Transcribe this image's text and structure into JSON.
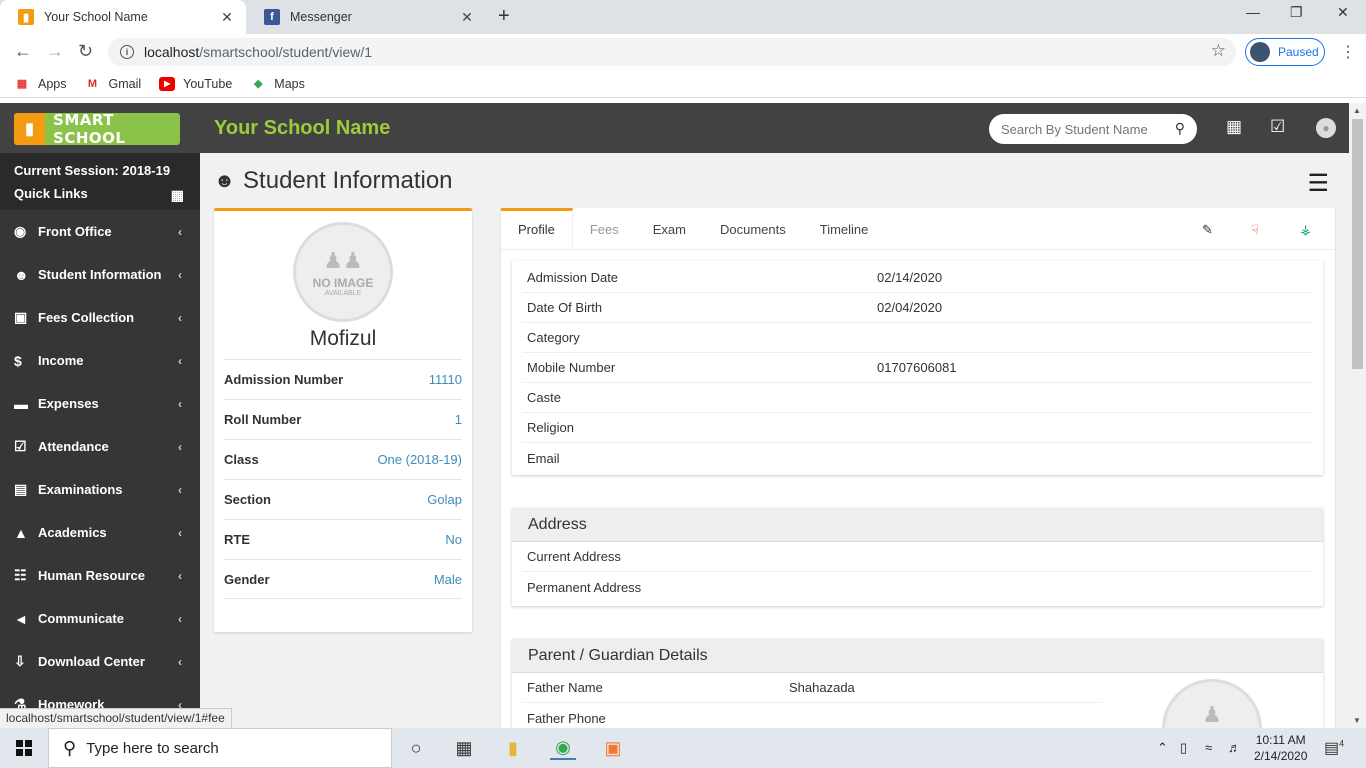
{
  "browser": {
    "tabs": [
      {
        "title": "Your School Name"
      },
      {
        "title": "Messenger"
      }
    ],
    "url_host": "localhost",
    "url_path": "/smartschool/student/view/1",
    "profile_label": "Paused",
    "bookmarks": [
      "Apps",
      "Gmail",
      "YouTube",
      "Maps"
    ]
  },
  "header": {
    "logo_text": "SMART SCHOOL",
    "school_name": "Your School Name",
    "search_placeholder": "Search By Student Name"
  },
  "sidebar": {
    "session": "Current Session: 2018-19",
    "quick_links": "Quick Links",
    "items": [
      {
        "label": "Front Office",
        "icon": "door-icon",
        "glyph": "◉"
      },
      {
        "label": "Student Information",
        "icon": "user-plus-icon",
        "glyph": "☻"
      },
      {
        "label": "Fees Collection",
        "icon": "money-icon",
        "glyph": "▣"
      },
      {
        "label": "Income",
        "icon": "dollar-icon",
        "glyph": "$"
      },
      {
        "label": "Expenses",
        "icon": "credit-card-icon",
        "glyph": "▬"
      },
      {
        "label": "Attendance",
        "icon": "calendar-check-icon",
        "glyph": "☑"
      },
      {
        "label": "Examinations",
        "icon": "map-icon",
        "glyph": "▤"
      },
      {
        "label": "Academics",
        "icon": "graduation-cap-icon",
        "glyph": "▲"
      },
      {
        "label": "Human Resource",
        "icon": "sitemap-icon",
        "glyph": "☷"
      },
      {
        "label": "Communicate",
        "icon": "bullhorn-icon",
        "glyph": "◄"
      },
      {
        "label": "Download Center",
        "icon": "download-icon",
        "glyph": "⇩"
      },
      {
        "label": "Homework",
        "icon": "flask-icon",
        "glyph": "⚗"
      }
    ]
  },
  "page": {
    "title": "Student Information"
  },
  "student": {
    "no_image": "NO IMAGE",
    "no_image_sub": "AVAILABLE",
    "name": "Mofizul",
    "details": [
      {
        "label": "Admission Number",
        "value": "11110"
      },
      {
        "label": "Roll Number",
        "value": "1"
      },
      {
        "label": "Class",
        "value": "One (2018-19)"
      },
      {
        "label": "Section",
        "value": "Golap"
      },
      {
        "label": "RTE",
        "value": "No"
      },
      {
        "label": "Gender",
        "value": "Male"
      }
    ]
  },
  "tabs": [
    "Profile",
    "Fees",
    "Exam",
    "Documents",
    "Timeline"
  ],
  "profile_fields": [
    {
      "label": "Admission Date",
      "value": "02/14/2020"
    },
    {
      "label": "Date Of Birth",
      "value": "02/04/2020"
    },
    {
      "label": "Category",
      "value": ""
    },
    {
      "label": "Mobile Number",
      "value": "01707606081"
    },
    {
      "label": "Caste",
      "value": ""
    },
    {
      "label": "Religion",
      "value": ""
    },
    {
      "label": "Email",
      "value": ""
    }
  ],
  "address": {
    "title": "Address",
    "fields": [
      {
        "label": "Current Address",
        "value": ""
      },
      {
        "label": "Permanent Address",
        "value": ""
      }
    ]
  },
  "guardian": {
    "title": "Parent / Guardian Details",
    "fields": [
      {
        "label": "Father Name",
        "value": "Shahazada"
      },
      {
        "label": "Father Phone",
        "value": ""
      }
    ]
  },
  "status_url": "localhost/smartschool/student/view/1#fee",
  "taskbar": {
    "search_placeholder": "Type here to search",
    "time": "10:11 AM",
    "date": "2/14/2020",
    "notif_count": "4"
  },
  "colors": {
    "accent": "#f39c12",
    "link": "#3c8dbc",
    "header_bg": "#424242",
    "sidebar_bg": "#363636",
    "school_name": "#9ccc3c"
  }
}
